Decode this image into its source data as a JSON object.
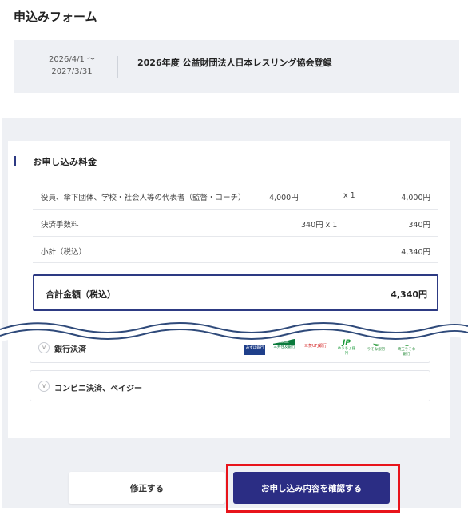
{
  "page": {
    "title": "申込みフォーム"
  },
  "period": {
    "start": "2026/4/1 ～",
    "end": "2027/3/31",
    "name": "2026年度 公益財団法人日本レスリング協会登録"
  },
  "fees": {
    "section_title": "お申し込み料金",
    "rows": [
      {
        "label": "役員、傘下団体、学校・社会人等の代表者（監督・コーチ）",
        "unit_price": "4,000円",
        "qty": "x 1",
        "total": "4,000円"
      },
      {
        "label": "決済手数料",
        "qty_combined": "340円 x 1",
        "total": "340円"
      },
      {
        "label": "小計（税込）",
        "total": "4,340円"
      }
    ],
    "grand_total_label": "合計金額（税込）",
    "grand_total": "4,340円"
  },
  "payment": {
    "bank_transfer": {
      "label": "銀行決済",
      "banks": [
        {
          "name": "Mizuho",
          "sub": "みずほ銀行"
        },
        {
          "name": "SMBC",
          "sub": "三井住友銀行"
        },
        {
          "name": "三菱UFJ銀行"
        },
        {
          "name": "JP",
          "sub": "ゆうちょ銀行"
        },
        {
          "name": "りそな銀行"
        },
        {
          "name": "埼玉りそな銀行"
        }
      ]
    },
    "convenience": {
      "label": "コンビニ決済、ペイジー"
    }
  },
  "actions": {
    "edit_label": "修正する",
    "confirm_label": "お申し込み内容を確認する"
  },
  "colors": {
    "accent": "#2b2d84",
    "highlight": "#e8141b",
    "panel_bg": "#eef0f4"
  }
}
